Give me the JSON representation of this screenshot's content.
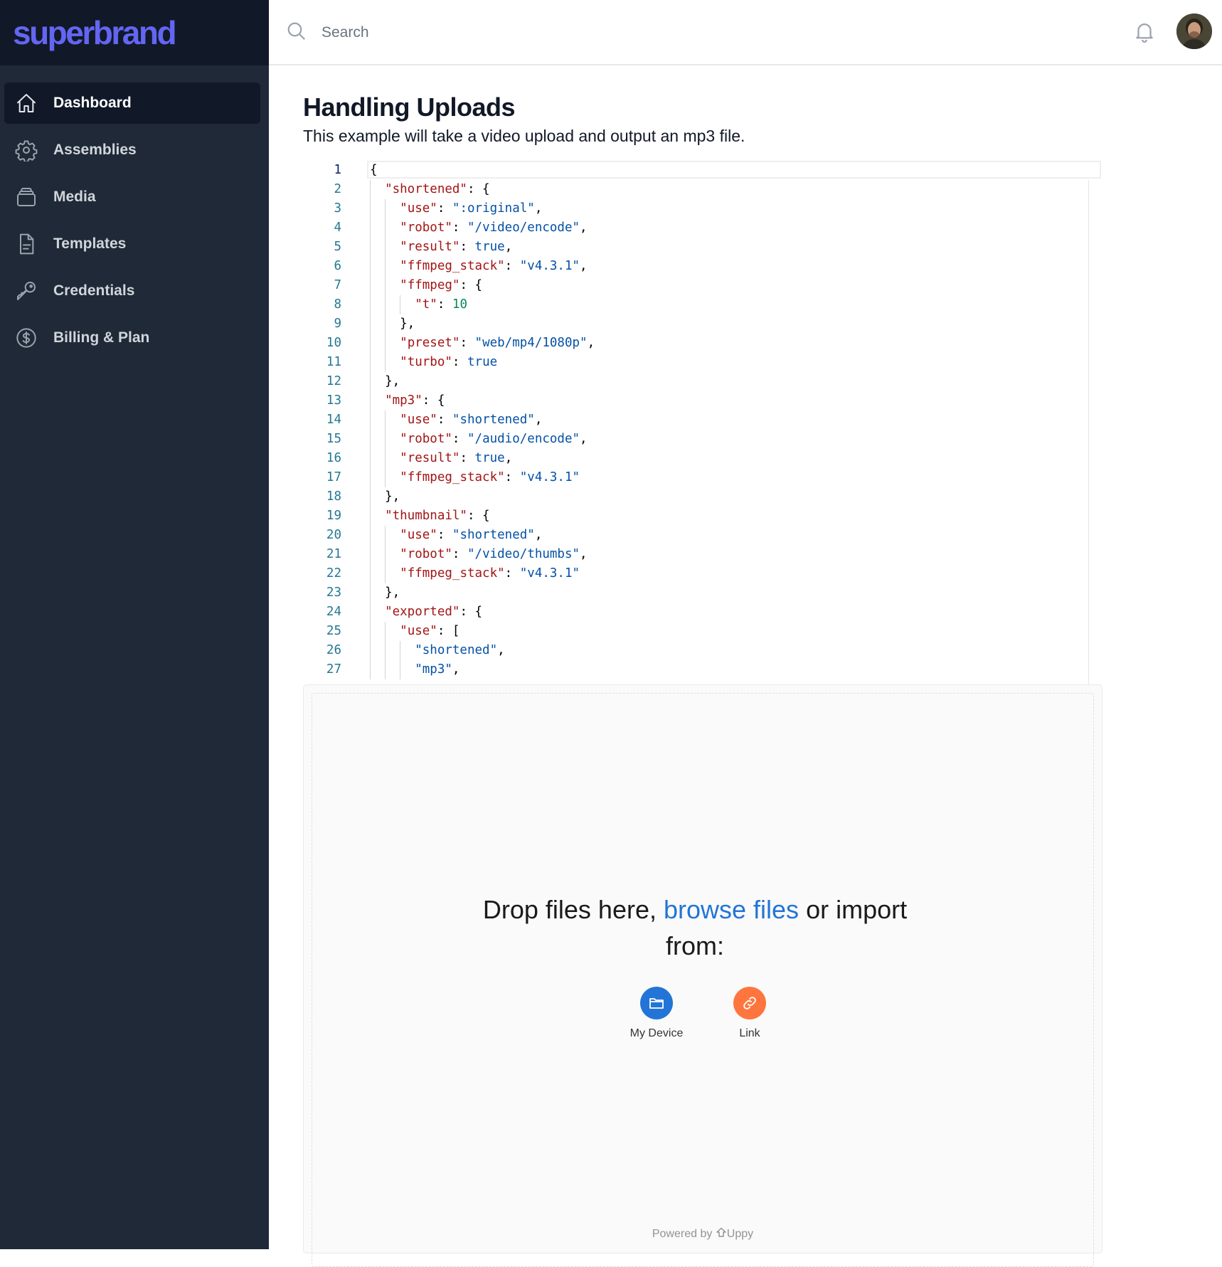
{
  "sidebar": {
    "brand": "superbrand",
    "items": [
      {
        "label": "Dashboard",
        "icon": "home-icon",
        "active": true
      },
      {
        "label": "Assemblies",
        "icon": "gear-icon",
        "active": false
      },
      {
        "label": "Media",
        "icon": "stack-icon",
        "active": false
      },
      {
        "label": "Templates",
        "icon": "document-icon",
        "active": false
      },
      {
        "label": "Credentials",
        "icon": "key-icon",
        "active": false
      },
      {
        "label": "Billing & Plan",
        "icon": "dollar-circle-icon",
        "active": false
      }
    ]
  },
  "header": {
    "search_placeholder": "Search",
    "notifications_icon": "bell-icon",
    "avatar_icon": "user-avatar"
  },
  "main": {
    "title": "Handling Uploads",
    "description": "This example will take a video upload and output an mp3 file."
  },
  "editor": {
    "lines": [
      "{",
      "  \"shortened\": {",
      "    \"use\": \":original\",",
      "    \"robot\": \"/video/encode\",",
      "    \"result\": true,",
      "    \"ffmpeg_stack\": \"v4.3.1\",",
      "    \"ffmpeg\": {",
      "      \"t\": 10",
      "    },",
      "    \"preset\": \"web/mp4/1080p\",",
      "    \"turbo\": true",
      "  },",
      "  \"mp3\": {",
      "    \"use\": \"shortened\",",
      "    \"robot\": \"/audio/encode\",",
      "    \"result\": true,",
      "    \"ffmpeg_stack\": \"v4.3.1\"",
      "  },",
      "  \"thumbnail\": {",
      "    \"use\": \"shortened\",",
      "    \"robot\": \"/video/thumbs\",",
      "    \"ffmpeg_stack\": \"v4.3.1\"",
      "  },",
      "  \"exported\": {",
      "    \"use\": [",
      "      \"shortened\",",
      "      \"mp3\","
    ],
    "colors": {
      "key": "#a31515",
      "string": "#0451a5",
      "number": "#098658",
      "line_number": "#237893"
    }
  },
  "uploader": {
    "drop_prefix": "Drop files here, ",
    "browse_label": "browse files",
    "drop_suffix": " or import from:",
    "sources": [
      {
        "label": "My Device",
        "icon": "folder-icon",
        "color": "#2275d7"
      },
      {
        "label": "Link",
        "icon": "link-icon",
        "color": "#ff753e"
      }
    ],
    "powered_by": "Powered by",
    "powered_brand": "Uppy"
  }
}
